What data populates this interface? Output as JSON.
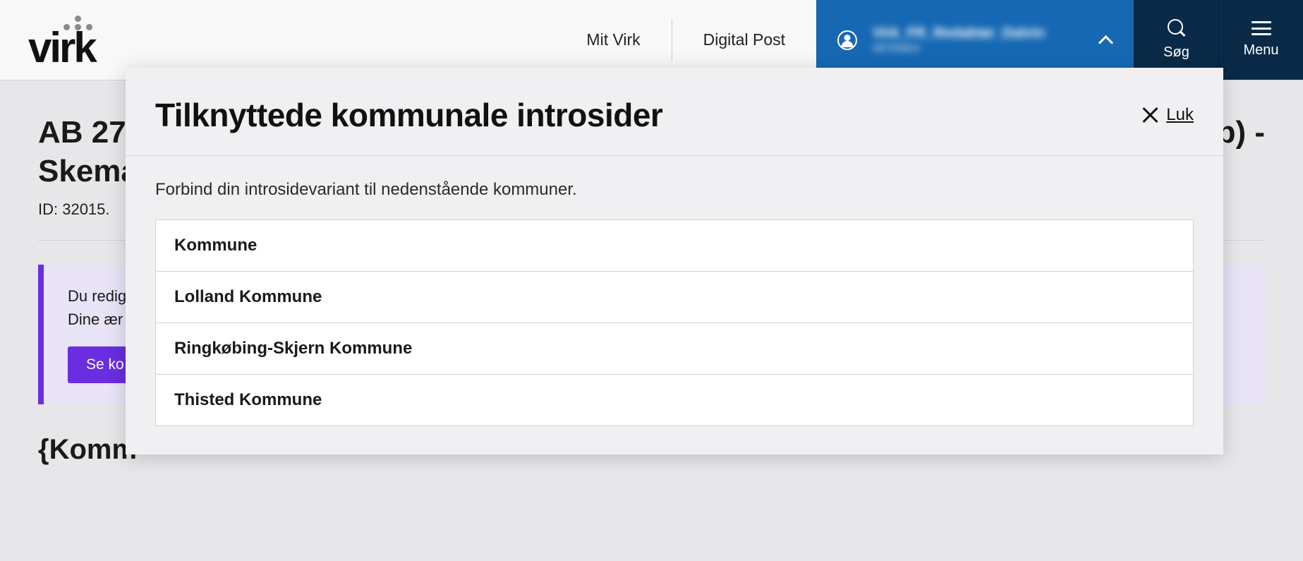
{
  "header": {
    "logo_text": "virk",
    "nav": {
      "mit_virk": "Mit Virk",
      "digital_post": "Digital Post"
    },
    "user": {
      "line1": "Virk_FR_Redaktør_Dalvin",
      "line2": "08705824"
    },
    "search_label": "Søg",
    "menu_label": "Menu"
  },
  "page": {
    "title_line1": "AB 27",
    "title_line1_suffix_visible": "ob) -",
    "title_line2": "Skema",
    "id_prefix": "ID: 32015.",
    "notice_line1": "Du redig",
    "notice_line2": "Dine ær",
    "notice_button": "Se ko",
    "sub_heading": "{Komm"
  },
  "modal": {
    "title": "Tilknyttede kommunale introsider",
    "close_label": "Luk",
    "description": "Forbind din introsidevariant til nedenstående kommuner.",
    "table_header": "Kommune",
    "rows": [
      "Lolland Kommune",
      "Ringkøbing-Skjern Kommune",
      "Thisted Kommune"
    ]
  }
}
